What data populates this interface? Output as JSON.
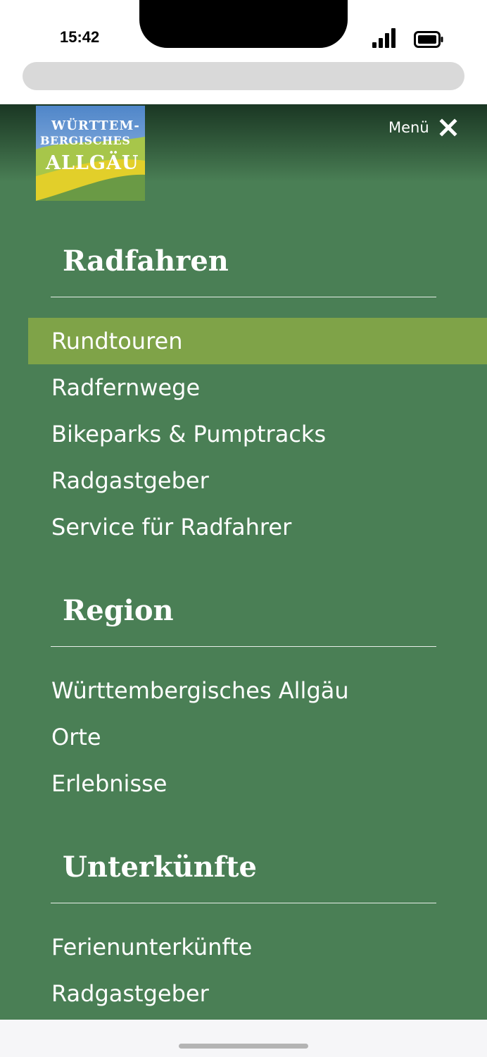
{
  "status_bar": {
    "time": "15:42"
  },
  "header": {
    "logo": {
      "line1": "WÜRTTEM-",
      "line2": "BERGISCHES",
      "line3": "ALLGÄU"
    },
    "menu_label": "Menü"
  },
  "sections": [
    {
      "title": "Radfahren",
      "items": [
        {
          "label": "Rundtouren",
          "active": true
        },
        {
          "label": "Radfernwege"
        },
        {
          "label": "Bikeparks & Pumptracks"
        },
        {
          "label": "Radgastgeber"
        },
        {
          "label": "Service für Radfahrer"
        }
      ]
    },
    {
      "title": "Region",
      "items": [
        {
          "label": "Württembergisches Allgäu"
        },
        {
          "label": "Orte"
        },
        {
          "label": "Erlebnisse"
        }
      ]
    },
    {
      "title": "Unterkünfte",
      "items": [
        {
          "label": "Ferienunterkünfte"
        },
        {
          "label": "Radgastgeber"
        }
      ]
    }
  ],
  "colors": {
    "panel_bg": "#4a7f55",
    "active_item_bg": "#7fa348",
    "text": "#ffffff"
  }
}
